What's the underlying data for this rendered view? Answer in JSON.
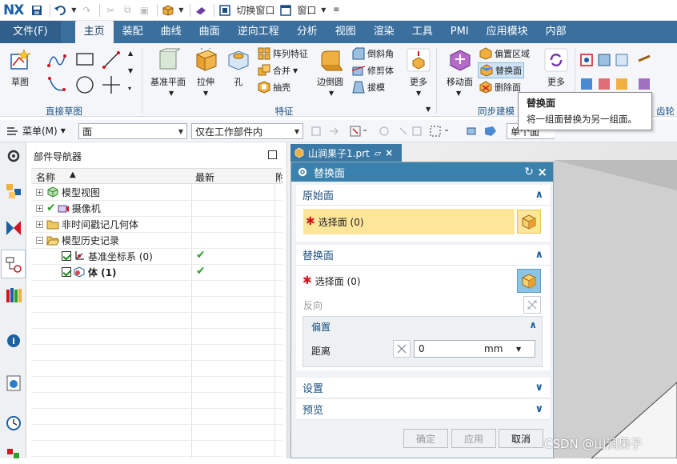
{
  "app": {
    "logo": "NX"
  },
  "quick_access": {
    "switch_window": "切换窗口",
    "window": "窗口"
  },
  "tabs": [
    {
      "label": "文件(F)"
    },
    {
      "label": "主页"
    },
    {
      "label": "装配"
    },
    {
      "label": "曲线"
    },
    {
      "label": "曲面"
    },
    {
      "label": "逆向工程"
    },
    {
      "label": "分析"
    },
    {
      "label": "视图"
    },
    {
      "label": "渲染"
    },
    {
      "label": "工具"
    },
    {
      "label": "PMI"
    },
    {
      "label": "应用模块"
    },
    {
      "label": "内部"
    }
  ],
  "ribbon": {
    "sketch": "草图",
    "direct_sketch_group": "直接草图",
    "datum_plane": "基准平面",
    "extrude": "拉伸",
    "hole": "孔",
    "pattern_feature": "阵列特征",
    "unite": "合并",
    "shell": "抽壳",
    "edge_blend": "边倒圆",
    "chamfer": "倒斜角",
    "trim_body": "修剪体",
    "draft": "拔模",
    "more1": "更多",
    "feature_group": "特征",
    "move_face": "移动面",
    "offset_region": "偏置区域",
    "replace_face": "替换面",
    "delete_face": "删除面",
    "more2": "更多",
    "sync_group": "同步建模",
    "gear_group": "齿轮"
  },
  "tooltip": {
    "title": "替换面",
    "description": "将一组面替换为另一组面。"
  },
  "selection_bar": {
    "menu": "菜单(M)",
    "filter": "面",
    "scope": "仅在工作部件内",
    "mode": "单个面"
  },
  "navigator": {
    "title": "部件导航器",
    "col_name": "名称",
    "col_latest": "最新",
    "col_extra": "附",
    "rows": [
      {
        "label": "模型视图"
      },
      {
        "label": "摄像机"
      },
      {
        "label": "非时间戳记几何体"
      },
      {
        "label": "模型历史记录"
      },
      {
        "label": "基准坐标系 (0)"
      },
      {
        "label": "体 (1)"
      }
    ]
  },
  "document_tab": {
    "title": "山涧果子1.prt"
  },
  "dialog": {
    "title": "替换面",
    "section_original": "原始面",
    "select_face_original": "选择面 (0)",
    "section_replace": "替换面",
    "select_face_replace": "选择面 (0)",
    "reverse": "反向",
    "section_offset": "偏置",
    "distance_label": "距离",
    "distance_value": "0",
    "distance_unit": "mm",
    "section_settings": "设置",
    "section_preview": "预览",
    "ok": "确定",
    "apply": "应用",
    "cancel": "取消"
  },
  "watermark": "CSDN @山涧果子"
}
